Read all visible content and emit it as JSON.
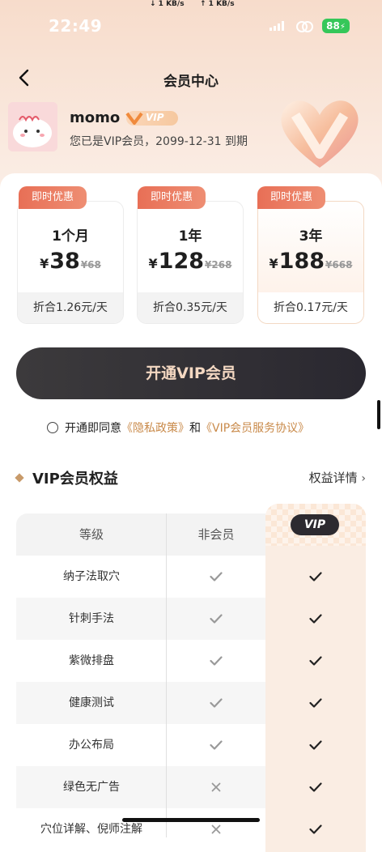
{
  "status_bar": {
    "time": "22:49",
    "download_speed": "↓ 1 KB/s",
    "upload_speed": "↑ 1 KB/s",
    "battery": "88"
  },
  "header": {
    "title": "会员中心"
  },
  "profile": {
    "username": "momo",
    "badge": "VIP",
    "status_text": "您已是VIP会员，2099-12-31 到期"
  },
  "plans": [
    {
      "promo": "即时优惠",
      "duration": "1个月",
      "currency": "¥",
      "price": "38",
      "original_price": "¥68",
      "daily": "折合1.26元/天",
      "selected": false
    },
    {
      "promo": "即时优惠",
      "duration": "1年",
      "currency": "¥",
      "price": "128",
      "original_price": "¥268",
      "daily": "折合0.35元/天",
      "selected": false
    },
    {
      "promo": "即时优惠",
      "duration": "3年",
      "currency": "¥",
      "price": "188",
      "original_price": "¥668",
      "daily": "折合0.17元/天",
      "selected": true
    }
  ],
  "cta": {
    "label": "开通VIP会员"
  },
  "agreement": {
    "prefix": "开通即同意",
    "privacy_link": "《隐私政策》",
    "conjunction": "和",
    "service_link": "《VIP会员服务协议》"
  },
  "benefits": {
    "title": "VIP会员权益",
    "detail_link": "权益详情",
    "columns": [
      "等级",
      "非会员",
      "VIP"
    ],
    "rows": [
      {
        "feature": "纳子法取穴",
        "free": "check",
        "vip": "check"
      },
      {
        "feature": "针刺手法",
        "free": "check",
        "vip": "check"
      },
      {
        "feature": "紫微排盘",
        "free": "check",
        "vip": "check"
      },
      {
        "feature": "健康测试",
        "free": "check",
        "vip": "check"
      },
      {
        "feature": "办公布局",
        "free": "check",
        "vip": "check"
      },
      {
        "feature": "绿色无广告",
        "free": "cross",
        "vip": "check"
      },
      {
        "feature": "穴位详解、倪师注解",
        "free": "cross",
        "vip": "check"
      }
    ]
  },
  "colors": {
    "accent_gold": "#c98a4a",
    "promo_red": "#e86f56",
    "cta_dark": "#2a2830",
    "battery_green": "#35c759"
  }
}
